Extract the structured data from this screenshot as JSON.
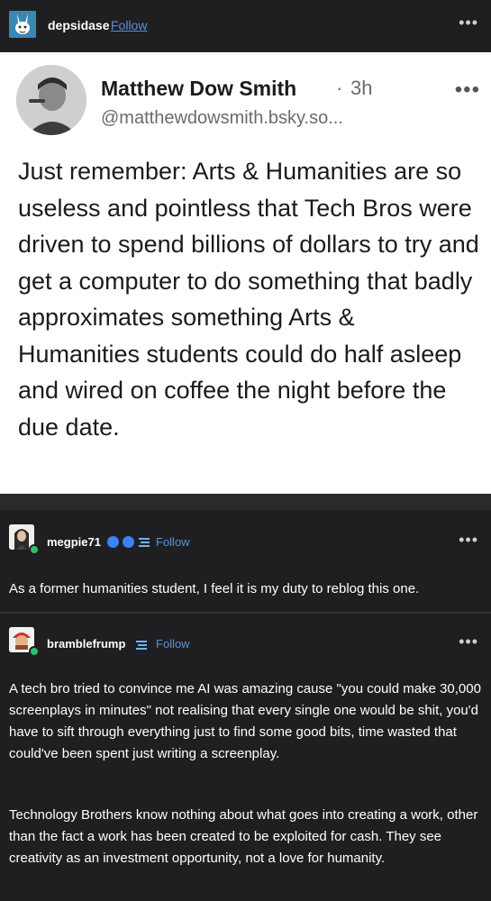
{
  "header": {
    "username": "depsidase",
    "follow_label": "Follow",
    "more_icon": "more-horizontal-icon"
  },
  "bluesky_post": {
    "display_name": "Matthew Dow Smith",
    "separator": "·",
    "time_ago": "3h",
    "handle": "@matthewdowsmith.bsky.so...",
    "body": "Just remember: Arts & Humanities are so useless and pointless that Tech Bros were driven to spend billions of dollars to try and get a computer to do something that badly approximates something Arts & Humanities students could do half asleep and wired on coffee the night before the due date."
  },
  "reblogs": [
    {
      "username": "megpie71",
      "follow_label": "Follow",
      "text": "As a former humanities student, I feel it is my duty to reblog this one."
    },
    {
      "username": "bramblefrump",
      "follow_label": "Follow",
      "paragraphs": [
        "A tech bro tried to convince me AI was amazing cause \"you could make 30,000 screenplays in minutes\" not realising that every single one would be shit, you'd have to sift through everything just to find some good bits, time wasted that could've been spent just writing a screenplay.",
        "Technology Brothers know nothing about what goes into creating a work, other than the fact a work has been created to be exploited for cash. They see creativity as an investment opportunity, not a love for humanity."
      ]
    }
  ],
  "colors": {
    "link": "#5b8fd8",
    "verified": "#3b82f6",
    "online_badge": "#2fbf6a",
    "dark_bg": "#1f1f22"
  }
}
